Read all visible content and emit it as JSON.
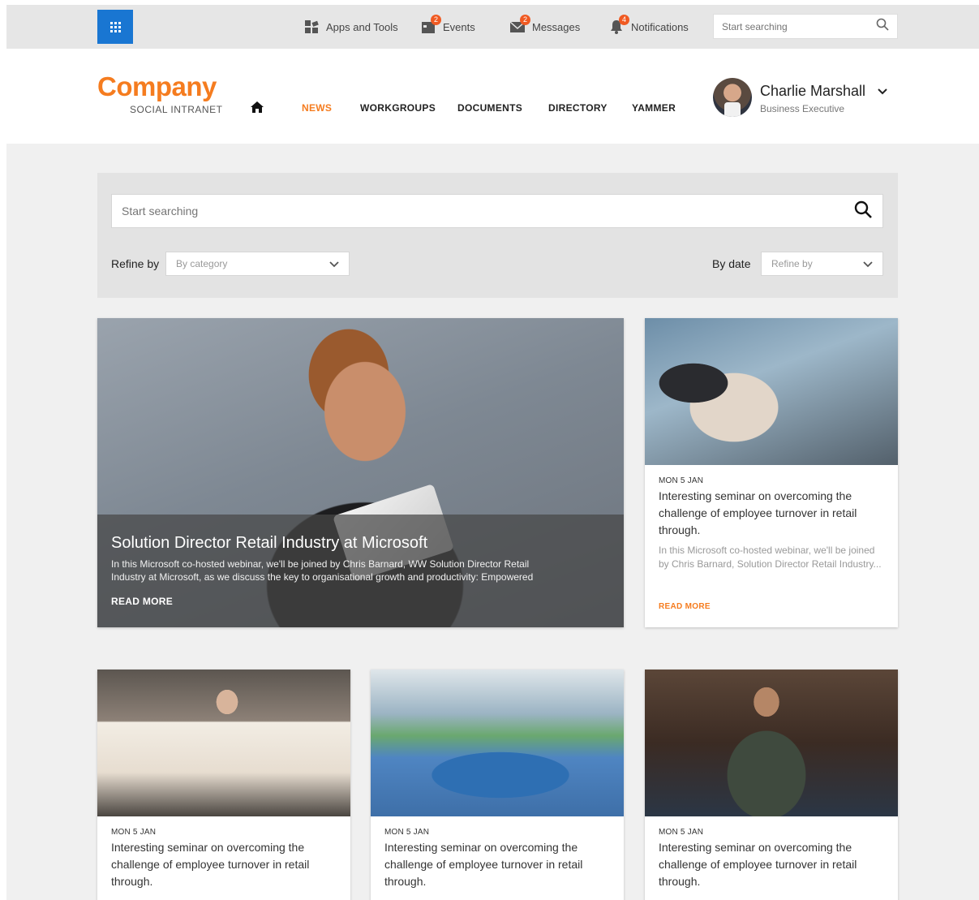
{
  "topbar": {
    "apps_tools": "Apps and Tools",
    "events": "Events",
    "events_count": "2",
    "messages": "Messages",
    "messages_count": "2",
    "notifications": "Notifications",
    "notifications_count": "4",
    "search_placeholder": "Start searching"
  },
  "brand": {
    "name": "Company",
    "subtitle": "SOCIAL INTRANET"
  },
  "nav": {
    "items": [
      "NEWS",
      "WORKGROUPS",
      "DOCUMENTS",
      "DIRECTORY",
      "YAMMER"
    ],
    "active": "NEWS"
  },
  "user": {
    "name": "Charlie Marshall",
    "role": "Business Executive"
  },
  "filter": {
    "search_placeholder": "Start searching",
    "refine_label": "Refine by",
    "category_value": "By category",
    "date_label": "By date",
    "date_value": "Refine by"
  },
  "featured": {
    "title": "Solution Director Retail Industry at Microsoft",
    "description": "In this Microsoft co-hosted webinar, we'll be joined by Chris Barnard, WW Solution Director Retail Industry at Microsoft, as we discuss the key to organisational growth and productivity: Empowered",
    "read_more": "READ MORE"
  },
  "side_card": {
    "date": "MON 5 JAN",
    "title": "Interesting seminar on overcoming the challenge of employee turnover in retail through.",
    "description": "In this Microsoft co-hosted webinar, we'll be joined by Chris Barnard,  Solution Director Retail Industry...",
    "read_more": "READ MORE"
  },
  "cards": [
    {
      "date": "MON 5 JAN",
      "title": "Interesting seminar on overcoming the challenge of employee turnover in retail through."
    },
    {
      "date": "MON 5 JAN",
      "title": "Interesting seminar on overcoming the challenge of employee turnover in retail through."
    },
    {
      "date": "MON 5 JAN",
      "title": "Interesting seminar on overcoming the challenge of employee turnover in retail through."
    }
  ],
  "colors": {
    "accent": "#f57c1f",
    "apps_button": "#1976d2",
    "badge": "#f05a22"
  },
  "icons": [
    "apps-grid-icon",
    "apps-tools-icon",
    "calendar-icon",
    "mail-icon",
    "bell-icon",
    "search-icon",
    "home-icon",
    "chevron-down-icon"
  ]
}
